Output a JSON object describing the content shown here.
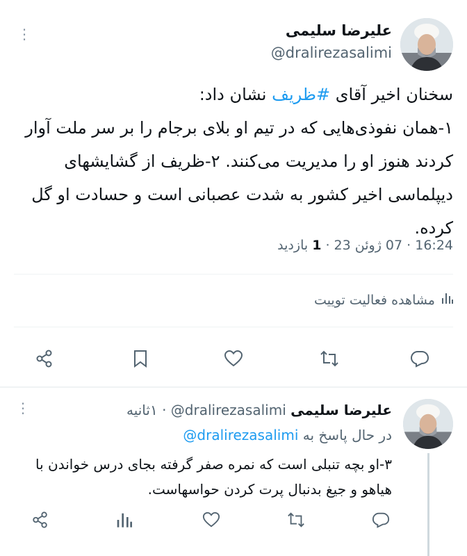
{
  "main_tweet": {
    "author_name": "علیرضا سلیمی",
    "handle": "@dralirezasalimi",
    "text_before": "سخنان اخیر آقای ",
    "hashtag": "#ظریف",
    "text_after": " نشان داد:\n۱-همان نفوذی‌هایی که در تیم او بلای برجام را بر سر ملت آوار کردند هنوز او را مدیریت می‌کنند. ۲-ظریف از گشایشهای دیپلماسی اخیر کشور به شدت عصبانی است و حسادت او گل کرده.",
    "time": "16:24",
    "sep1": " · ",
    "date": "07 ژوئن 23",
    "sep2": " · ",
    "views_count": "1",
    "views_label": " بازدید",
    "activity_label": "مشاهده فعالیت توییت"
  },
  "reply": {
    "author_name": "علیرضا سلیمی",
    "handle": "@dralirezasalimi",
    "sep": " · ",
    "time": "۱ثانیه",
    "replying_prefix": "در حال پاسخ به ",
    "replying_to": "@dralirezasalimi",
    "text": "۳-او بچه تنبلی است که نمره صفر گرفته بجای درس خواندن با هیاهو و جیغ بدنبال پرت کردن حواسهاست."
  },
  "icons": {
    "reply": "reply-icon",
    "retweet": "retweet-icon",
    "like": "like-icon",
    "bookmark": "bookmark-icon",
    "share": "share-icon",
    "analytics": "analytics-icon"
  },
  "colors": {
    "accent": "#1d9bf0",
    "secondary_text": "#536471",
    "primary_text": "#0f1419"
  }
}
